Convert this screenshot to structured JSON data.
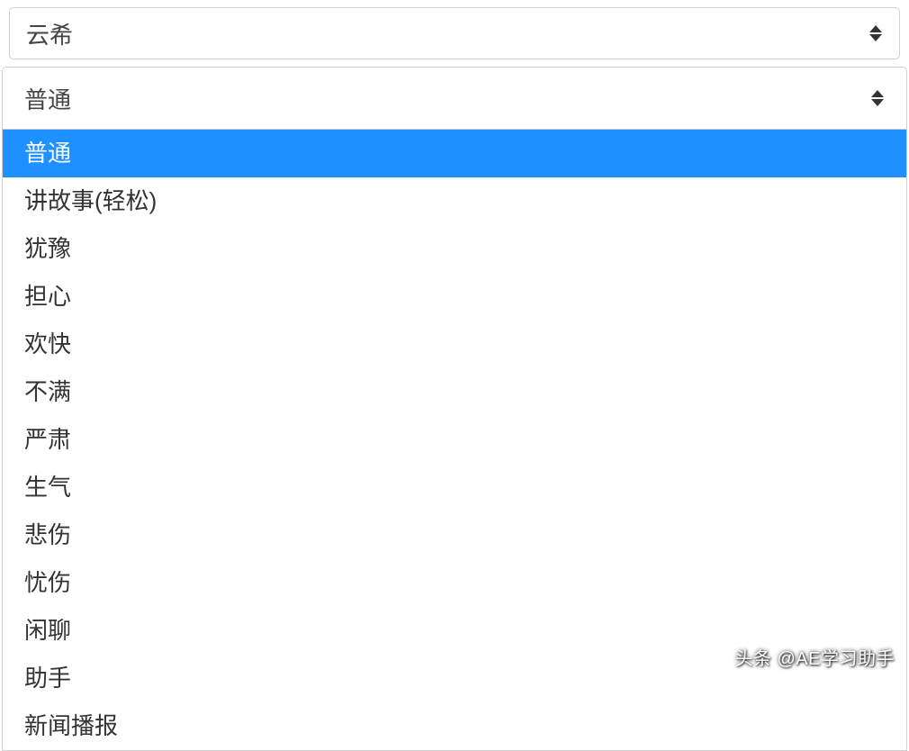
{
  "select_voice": {
    "value": "云希"
  },
  "select_style": {
    "value": "普通"
  },
  "dropdown": {
    "items": [
      {
        "label": "普通",
        "highlighted": true
      },
      {
        "label": "讲故事(轻松)",
        "highlighted": false
      },
      {
        "label": "犹豫",
        "highlighted": false
      },
      {
        "label": "担心",
        "highlighted": false
      },
      {
        "label": "欢快",
        "highlighted": false
      },
      {
        "label": "不满",
        "highlighted": false
      },
      {
        "label": "严肃",
        "highlighted": false
      },
      {
        "label": "生气",
        "highlighted": false
      },
      {
        "label": "悲伤",
        "highlighted": false
      },
      {
        "label": "忧伤",
        "highlighted": false
      },
      {
        "label": "闲聊",
        "highlighted": false
      },
      {
        "label": "助手",
        "highlighted": false
      },
      {
        "label": "新闻播报",
        "highlighted": false
      }
    ]
  },
  "watermark": {
    "text": "头条 @AE学习助手"
  }
}
